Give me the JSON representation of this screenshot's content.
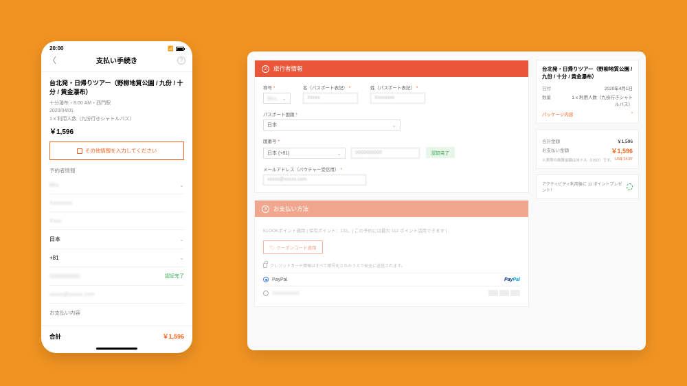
{
  "phone": {
    "time": "20:00",
    "nav_title": "支払い手続き",
    "tour_title": "台北発・日帰りツアー（野柳地質公園 / 九份 / 十分 / 黄金瀑布）",
    "tour_sub": "十分瀑布・8:00 AM・西門駅",
    "date": "2020/04/01",
    "qty": "1 x 利用人数（九份行きシャトルバス）",
    "price": "￥1,596",
    "info_btn": "その他情報を入力してください",
    "booker_label": "予約者情報",
    "f_title": "Mrs.",
    "f_name1": "Xxxxxxxx",
    "f_name2": "Xxxx",
    "f_country": "日本",
    "f_code": "+81",
    "f_phone": "0000000000",
    "f_email": "xxxxx@xxxxx.com",
    "verify": "認証完了",
    "pay_label": "お支払い内容",
    "total_label": "合計",
    "total_val": "￥1,596"
  },
  "desk": {
    "traveler": {
      "hdr_num": "2",
      "hdr": "旅行者情報",
      "lbl_title": "称号",
      "lbl_first": "名（パスポート表記）",
      "lbl_last": "姓（パスポート表記）",
      "val_title": "Mrs.",
      "val_first": "Xxxxx",
      "val_last": "Xxxxxxxx",
      "lbl_nat": "パスポート国籍",
      "val_nat": "日本",
      "lbl_phone": "国番号",
      "val_code": "日本 (+81)",
      "val_phone": "0000000000",
      "verify": "認証完了",
      "lbl_email": "メールアドレス（バウチャー受信用）",
      "val_email": "xxxxx@xxxxx.com",
      "req": "*"
    },
    "payment": {
      "hdr_num": "3",
      "hdr": "お支払い方法",
      "points": "KLOOKポイント適用 | 保有ポイント：132。| この予約には最大 112 ポイント活用できます |",
      "coupon": "クーポンコード適用",
      "cc_note": "クレジットカード情報はすべて暗号化されたうえで安全に送信されます。",
      "paypal": "PayPal"
    },
    "side": {
      "title": "台北発・日帰りツアー（野柳地質公園 / 九份 / 十分 / 黄金瀑布）",
      "date_lbl": "日付",
      "date_val": "2020年4月1日",
      "qty_lbl": "数量",
      "qty_val": "1 x 利用人数（九份行きシャトルバス）",
      "pkg": "パッケージ内容",
      "subtotal_lbl": "合計金額",
      "subtotal_val": "￥1,596",
      "total_lbl": "お支払い金額",
      "total_val": "￥1,596",
      "usd_note": "※実際の換算金額は米ドル（USD）です。",
      "usd_val": "US$ 14.87",
      "pts": "アクティビティ利用後に 11 ポイントプレゼント！"
    }
  }
}
